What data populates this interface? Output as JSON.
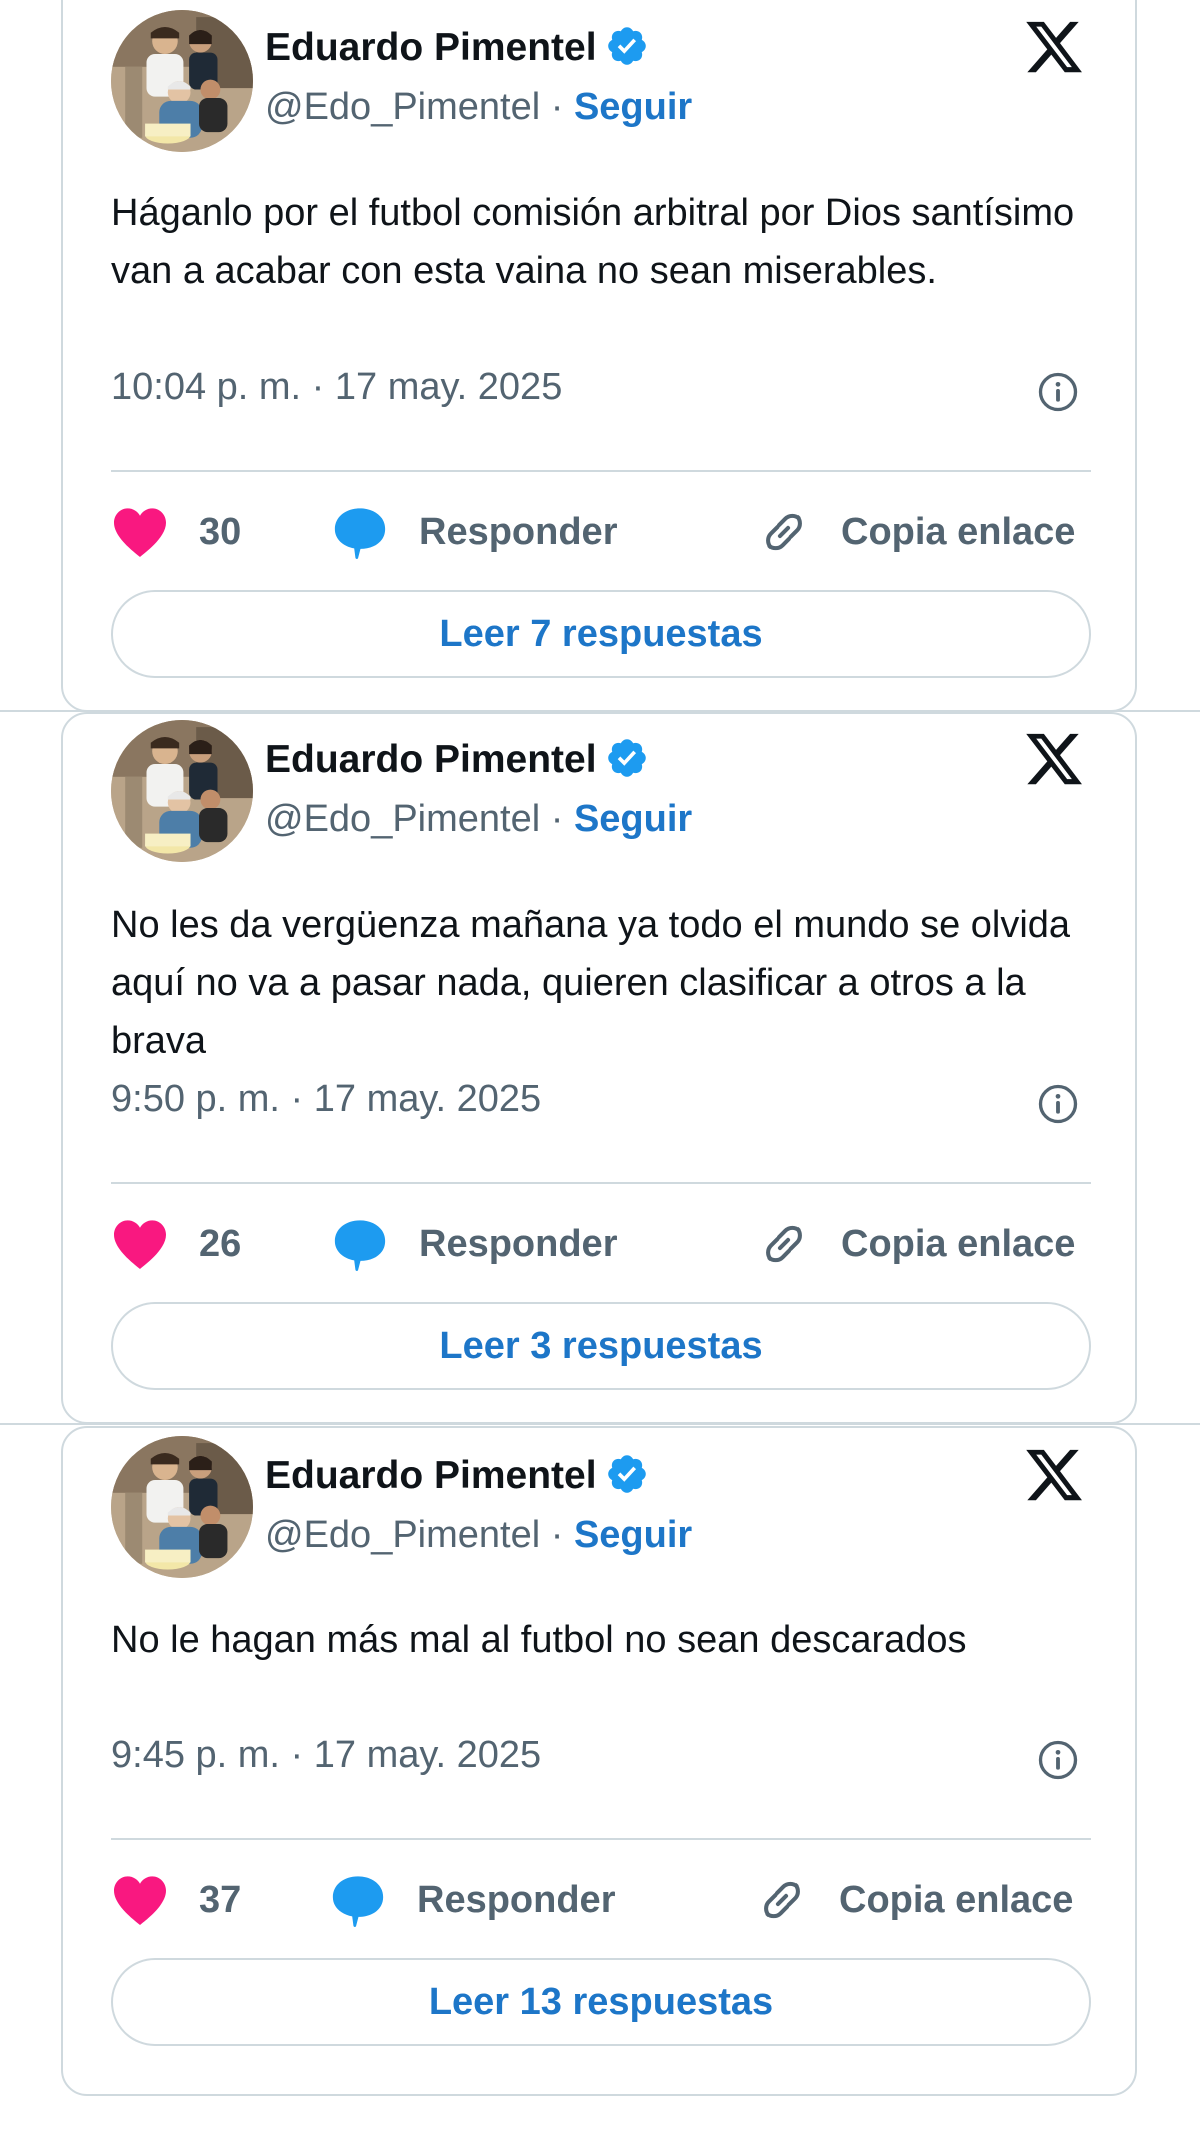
{
  "colors": {
    "accent": "#1d76c8",
    "heart": "#f91880",
    "verified": "#1d9bf0",
    "muted_text": "#536471",
    "border": "#cfd9de"
  },
  "icons": [
    "verified-badge-icon",
    "x-logo-icon",
    "info-icon",
    "heart-icon",
    "reply-bubble-icon",
    "link-icon"
  ],
  "tweets": [
    {
      "author_name": "Eduardo Pimentel",
      "handle": "@Edo_Pimentel",
      "separator": "·",
      "follow_label": "Seguir",
      "text": "Háganlo por el futbol comisión arbitral por Dios santísimo van a acabar con esta vaina no sean miserables.",
      "time": "10:04 p. m. · 17 may. 2025",
      "likes": "30",
      "reply_label": "Responder",
      "copy_link_label": "Copia enlace",
      "read_replies_label": "Leer 7 respuestas"
    },
    {
      "author_name": "Eduardo Pimentel",
      "handle": "@Edo_Pimentel",
      "separator": "·",
      "follow_label": "Seguir",
      "text": "No les da vergüenza mañana ya todo el mundo se olvida aquí no va a pasar nada, quieren clasificar a otros a la brava",
      "time": "9:50 p. m. · 17 may. 2025",
      "likes": "26",
      "reply_label": "Responder",
      "copy_link_label": "Copia enlace",
      "read_replies_label": "Leer 3 respuestas"
    },
    {
      "author_name": "Eduardo Pimentel",
      "handle": "@Edo_Pimentel",
      "separator": "·",
      "follow_label": "Seguir",
      "text": "No le hagan más mal al futbol no sean descarados",
      "time": "9:45 p. m. · 17 may. 2025",
      "likes": "37",
      "reply_label": "Responder",
      "copy_link_label": "Copia enlace",
      "read_replies_label": "Leer 13 respuestas"
    }
  ]
}
